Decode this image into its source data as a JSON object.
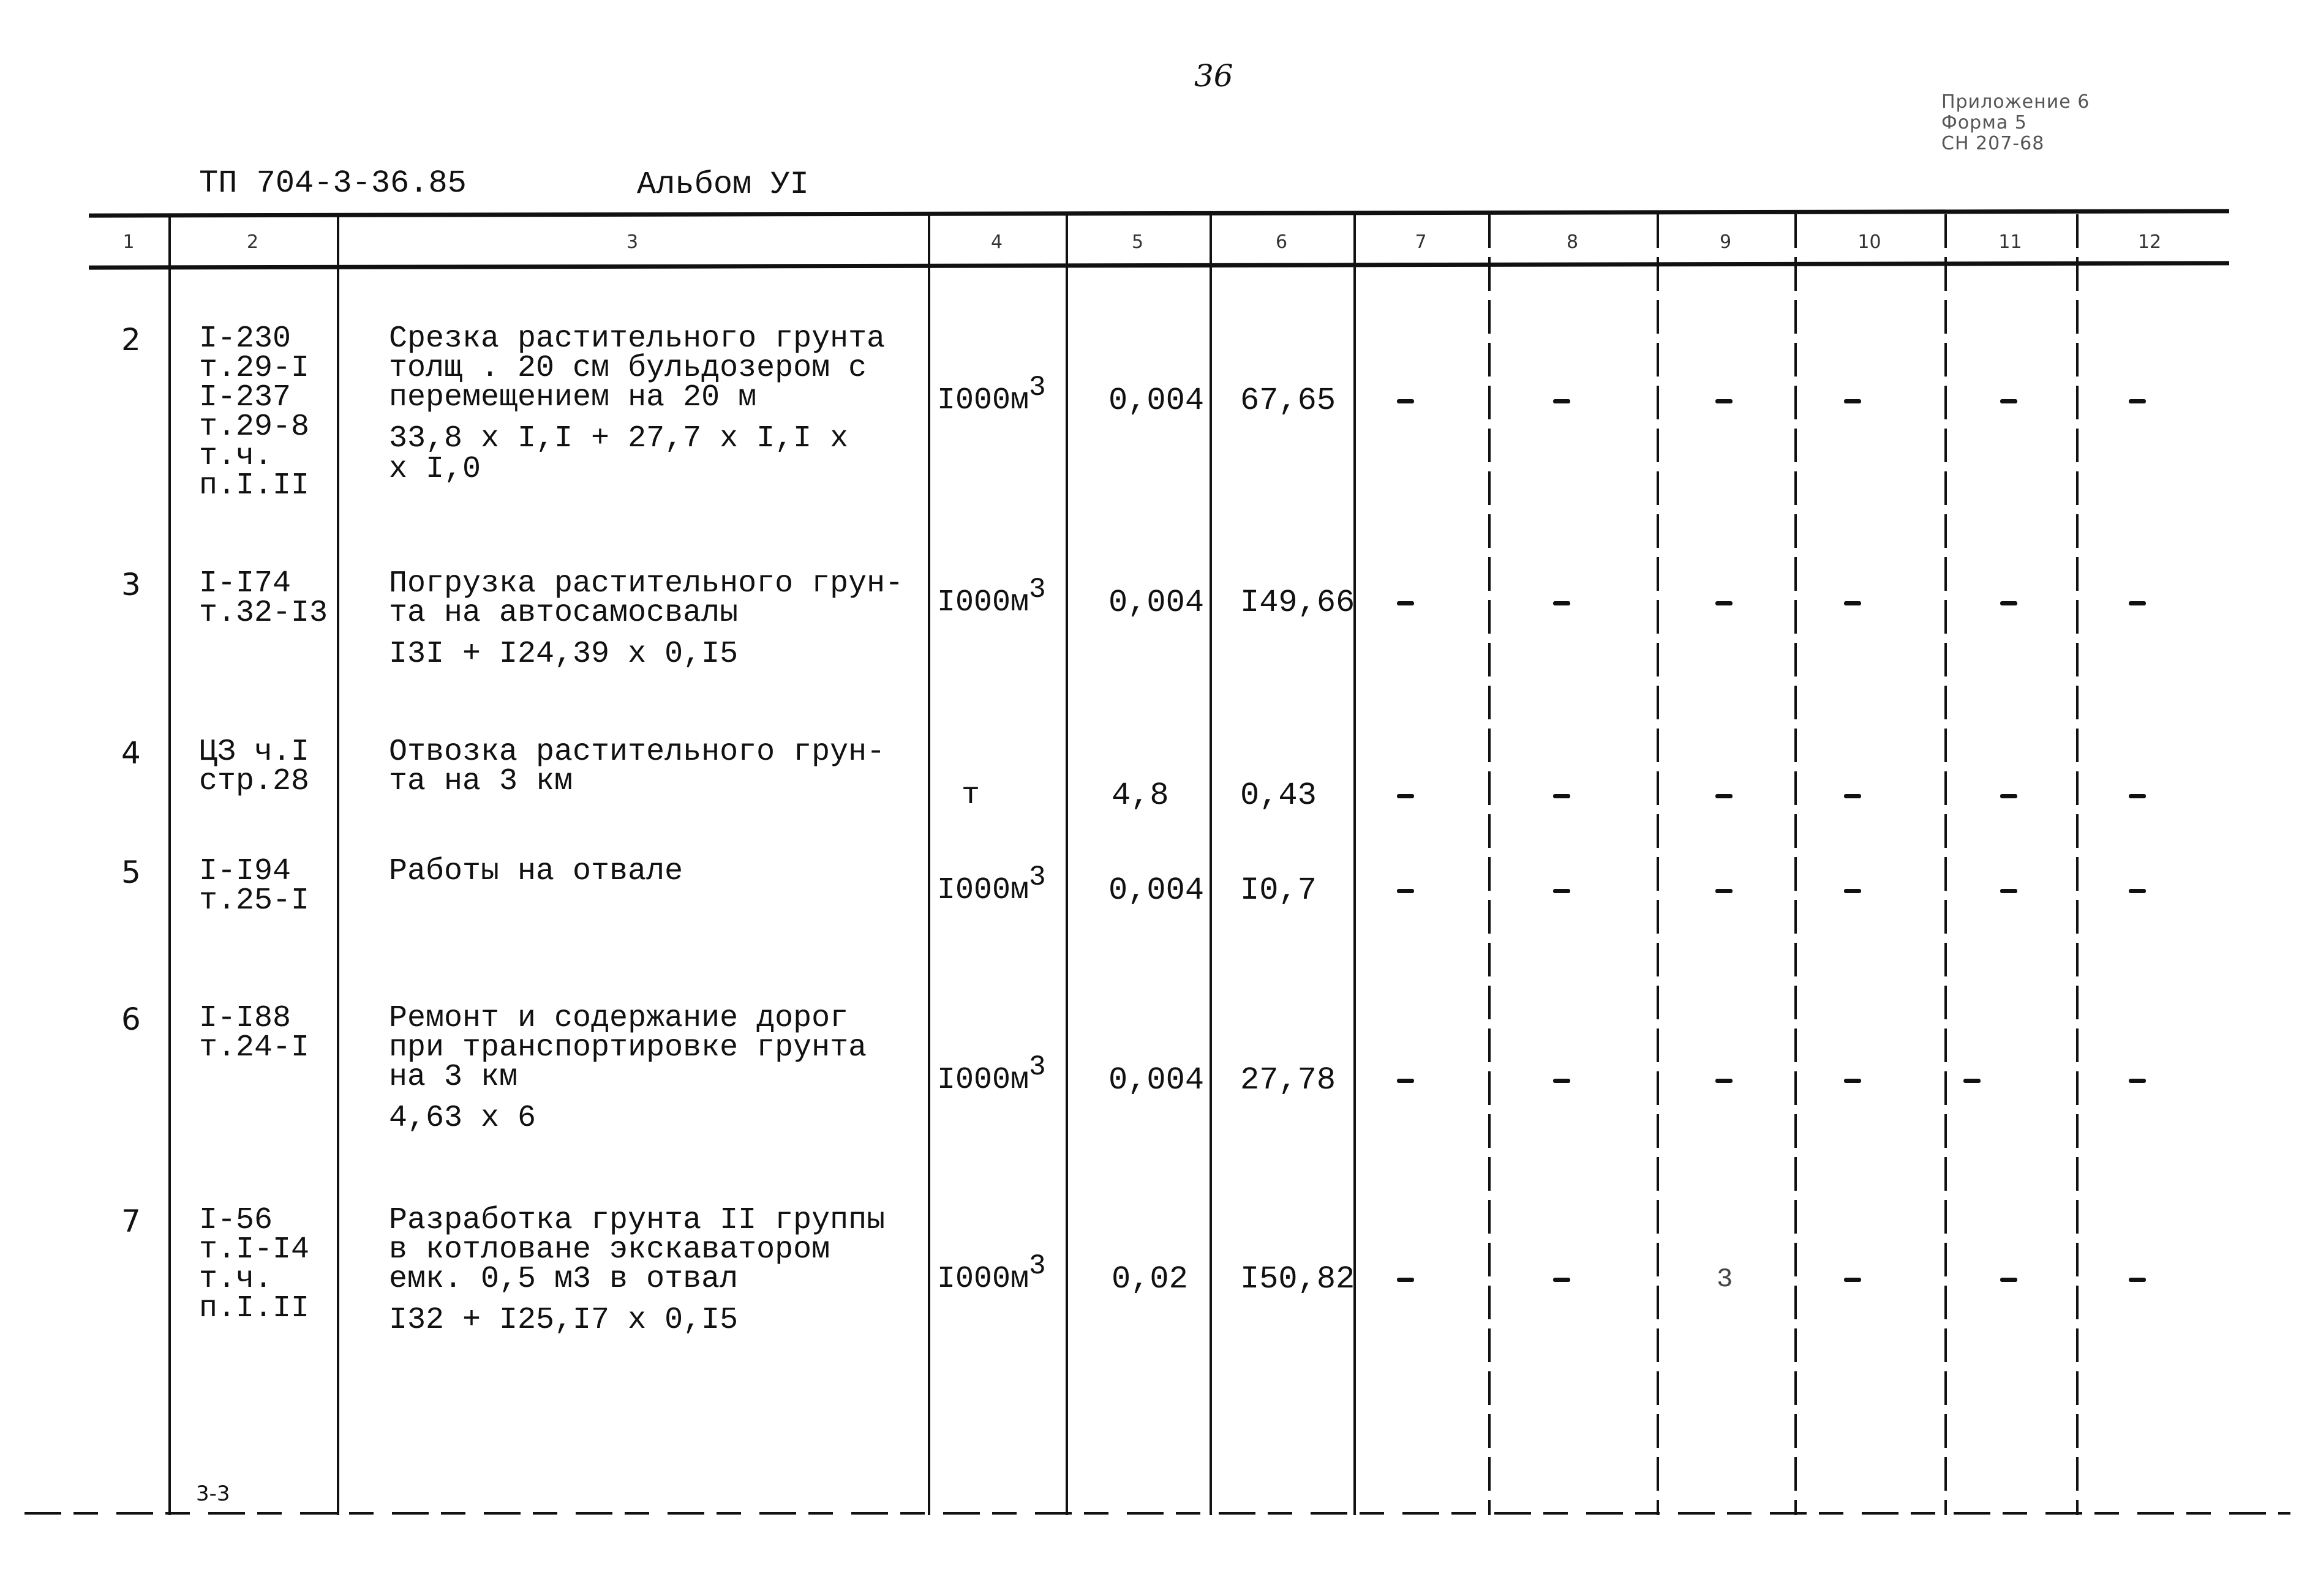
{
  "page": {
    "number": "36",
    "corner_note": [
      "Приложение 6",
      "Форма 5",
      "СН 207-68"
    ],
    "doc_code": "ТП 704-3-36.85",
    "album": "Альбом УI",
    "footer_code": "3-3"
  },
  "table": {
    "header": [
      "1",
      "2",
      "3",
      "4",
      "5",
      "6",
      "7",
      "8",
      "9",
      "10",
      "11",
      "12"
    ],
    "rows": [
      {
        "num": "2",
        "ref": "I-230\nт.29-I\nI-237\nт.29-8\nт.ч.\nп.I.II",
        "desc": "Срезка растительного грунта\nтолщ . 20 см бульдозером с\nперемещением на 20 м",
        "formula": "33,8 x I,I + 27,7 x I,I x\nx I,0",
        "unit": "I000м",
        "unit_sup": "3",
        "qty": "0,004",
        "value": "67,65",
        "col7": "–",
        "col8": "–",
        "col9": "–",
        "col10": "–",
        "col11": "–",
        "col12": "–"
      },
      {
        "num": "3",
        "ref": "I-I74\nт.32-I3",
        "desc": "Погрузка растительного грун-\nта на автосамосвалы",
        "formula": "I3I + I24,39 x 0,I5",
        "unit": "I000м",
        "unit_sup": "3",
        "qty": "0,004",
        "value": "I49,66",
        "col7": "–",
        "col8": "–",
        "col9": "–",
        "col10": "–",
        "col11": "–",
        "col12": "–"
      },
      {
        "num": "4",
        "ref": "ЦЗ ч.I\nстр.28",
        "desc": "Отвозка растительного грун-\nта на 3 км",
        "formula": "",
        "unit": "т",
        "unit_sup": "",
        "qty": "4,8",
        "value": "0,43",
        "col7": "–",
        "col8": "–",
        "col9": "–",
        "col10": "–",
        "col11": "–",
        "col12": "–"
      },
      {
        "num": "5",
        "ref": "I-I94\nт.25-I",
        "desc": "Работы на отвале",
        "formula": "",
        "unit": "I000м",
        "unit_sup": "3",
        "qty": "0,004",
        "value": "I0,7",
        "col7": "–",
        "col8": "–",
        "col9": "–",
        "col10": "–",
        "col11": "–",
        "col12": "–"
      },
      {
        "num": "6",
        "ref": "I-I88\nт.24-I",
        "desc": "Ремонт и содержание дорог\nпри транспортировке грунта\nна 3 км",
        "formula": "4,63 x 6",
        "unit": "I000м",
        "unit_sup": "3",
        "qty": "0,004",
        "value": "27,78",
        "col7": "–",
        "col8": "–",
        "col9": "–",
        "col10": "–",
        "col11": "–",
        "col12": "–"
      },
      {
        "num": "7",
        "ref": "I-56\nт.I-I4\nт.ч.\nп.I.II",
        "desc": "Разработка грунта II группы\nв котловане экскаватором\nемк. 0,5 м3 в отвал",
        "formula": "I32 + I25,I7 x 0,I5",
        "unit": "I000м",
        "unit_sup": "3",
        "qty": "0,02",
        "value": "I50,82",
        "col7": "–",
        "col8": "–",
        "col9": "3",
        "col10": "–",
        "col11": "–",
        "col12": "–"
      }
    ]
  }
}
